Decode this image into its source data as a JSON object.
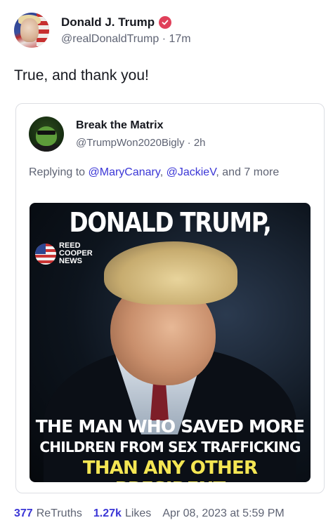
{
  "post": {
    "author": {
      "display_name": "Donald J. Trump",
      "handle": "@realDonaldTrump",
      "time_ago": "17m",
      "verified_icon": "verified-badge-icon",
      "verified_color": "#e0405a"
    },
    "text": "True, and thank you!"
  },
  "quote": {
    "author": {
      "display_name": "Break the Matrix",
      "handle": "@TrumpWon2020Bigly",
      "time_ago": "2h"
    },
    "replying_to": {
      "prefix": "Replying to",
      "mentions": [
        "@MaryCanary",
        "@JackieV"
      ],
      "suffix": ", and 7 more"
    },
    "image": {
      "headline_top": "DONALD TRUMP,",
      "logo_text": [
        "REED",
        "COOPER",
        "NEWS"
      ],
      "line_1": "THE MAN WHO SAVED MORE",
      "line_2": "CHILDREN FROM SEX TRAFFICKING",
      "line_3": "THAN ANY OTHER PRESIDENT"
    }
  },
  "stats": {
    "retruths_count": "377",
    "retruths_label": "ReTruths",
    "likes_count": "1.27k",
    "likes_label": "Likes",
    "timestamp": "Apr 08, 2023 at 5:59 PM",
    "accent_color": "#3b36d6"
  }
}
